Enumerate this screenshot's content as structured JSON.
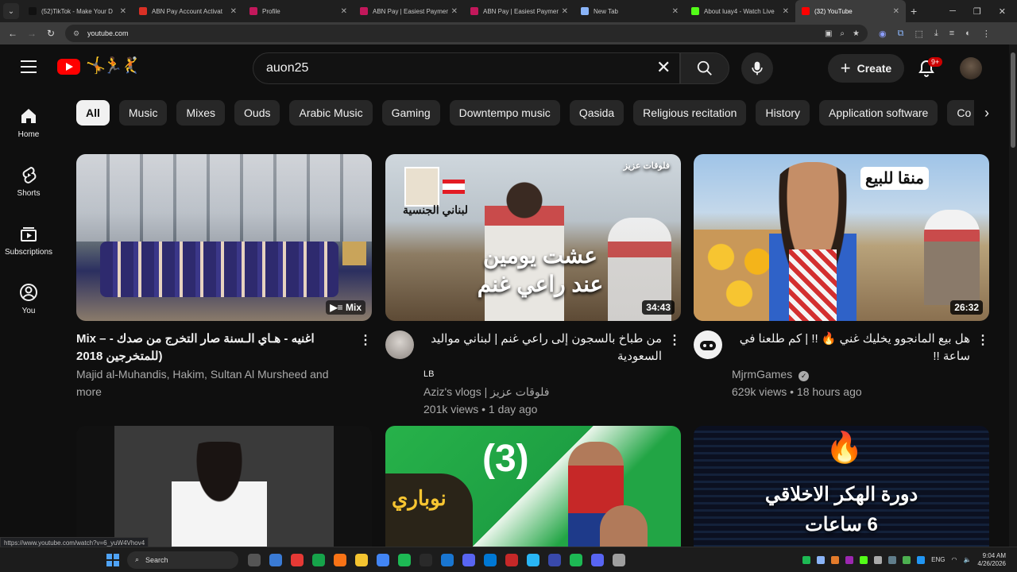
{
  "browser": {
    "tabs": [
      {
        "label": "(52)TikTok - Make Your D",
        "color": "#111111"
      },
      {
        "label": "ABN Pay Account Activat",
        "color": "#d93025"
      },
      {
        "label": "Profile",
        "color": "#c2185b"
      },
      {
        "label": "ABN Pay | Easiest Paymen",
        "color": "#c2185b"
      },
      {
        "label": "ABN Pay | Easiest Paymen",
        "color": "#c2185b"
      },
      {
        "label": "New Tab",
        "color": "#8ab4f8"
      },
      {
        "label": "About luay4 - Watch Live",
        "color": "#53fc18"
      },
      {
        "label": "(32) YouTube",
        "color": "#ff0000",
        "active": true
      }
    ],
    "url": "youtube.com",
    "hover_url": "https://www.youtube.com/watch?v=6_yuW4Vhov4"
  },
  "header": {
    "search_query": "auon25",
    "create_label": "Create",
    "notification_count": "9+"
  },
  "sidebar": {
    "items": [
      {
        "label": "Home",
        "icon": "home-icon"
      },
      {
        "label": "Shorts",
        "icon": "shorts-icon"
      },
      {
        "label": "Subscriptions",
        "icon": "subscriptions-icon"
      },
      {
        "label": "You",
        "icon": "you-icon"
      }
    ]
  },
  "chips": [
    "All",
    "Music",
    "Mixes",
    "Ouds",
    "Arabic Music",
    "Gaming",
    "Downtempo music",
    "Qasida",
    "Religious recitation",
    "History",
    "Application software",
    "Co"
  ],
  "videos": [
    {
      "title": "Mix – اغنيه - هـاي الـسنة صار التخرج من صدك - (للمتخرجين 2018",
      "channel": "Majid al-Muhandis, Hakim, Sultan Al Mursheed and more",
      "stats": "",
      "badge": "Mix"
    },
    {
      "title": "من طباخ بالسجون إلى راعي غنم | لبناني مواليد السعودية",
      "title_line2": "LB",
      "channel": "Aziz's vlogs | فلوقات عزيز",
      "stats": "201k views • 1 day ago",
      "duration": "34:43",
      "thumb_text": "عشت يومين عند راعي غنم",
      "thumb_tag": "فلوقات عزيز",
      "thumb_label": "لبناني الجنسية"
    },
    {
      "title": "هل بيع المانجوو يخليك غني 🔥 !! | كم طلعنا في ساعة !!",
      "channel": "MjrmGames",
      "stats": "629k views • 18 hours ago",
      "duration": "26:32",
      "thumb_text": "منقا للبيع"
    },
    {
      "thumb_text": ""
    },
    {
      "thumb_text": "(3)"
    },
    {
      "thumb_text": "دورة الهكر الاخلاقي",
      "thumb_text2": "6 ساعات"
    }
  ],
  "taskbar": {
    "search_label": "Search",
    "lang": "ENG",
    "time": "9:04 AM",
    "date": "4/26/2026"
  }
}
